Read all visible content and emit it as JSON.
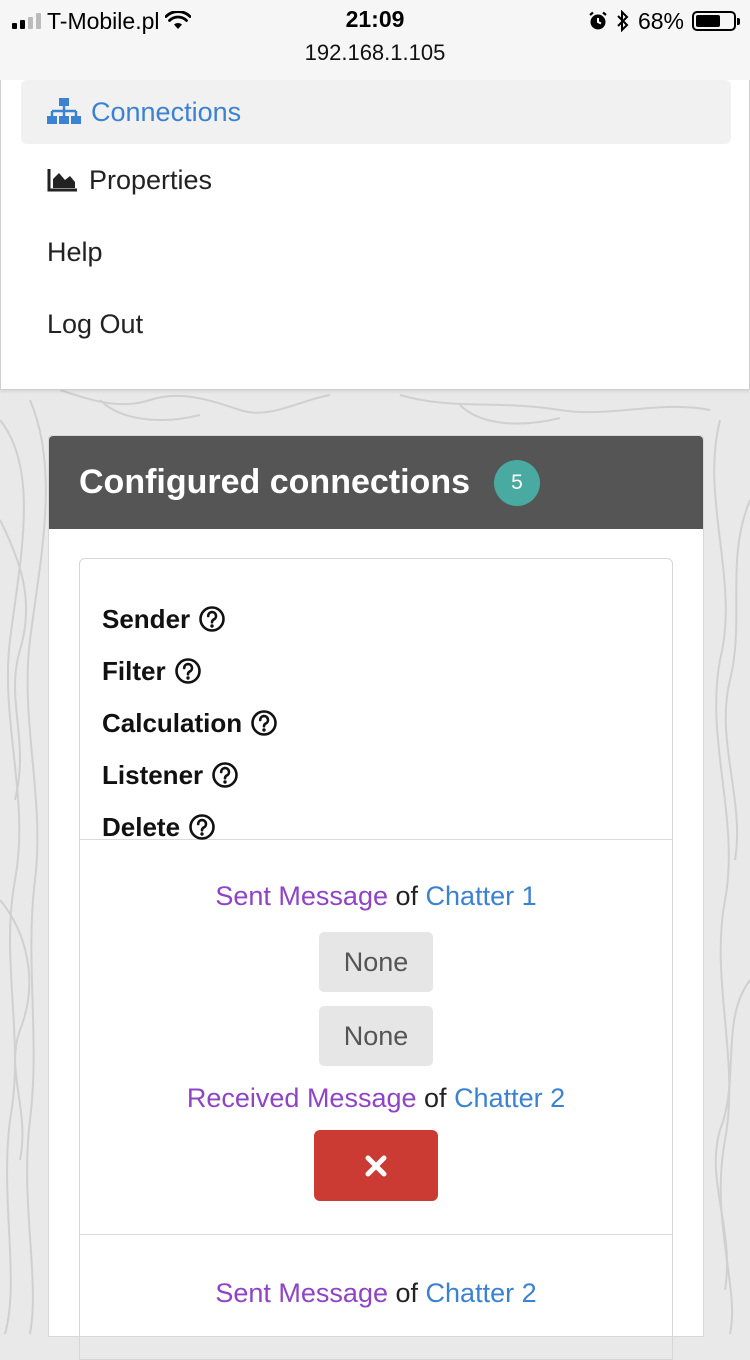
{
  "status_bar": {
    "carrier": "T-Mobile.pl",
    "time": "21:09",
    "url": "192.168.1.105",
    "battery_percent": "68%",
    "battery_level": 0.68
  },
  "nav": {
    "items": [
      {
        "label": "Connections",
        "icon": "sitemap-icon",
        "active": true
      },
      {
        "label": "Properties",
        "icon": "area-chart-icon",
        "active": false
      },
      {
        "label": "Help",
        "active": false
      },
      {
        "label": "Log Out",
        "active": false
      }
    ]
  },
  "panel": {
    "title": "Configured connections",
    "count": "5",
    "legend": [
      "Sender",
      "Filter",
      "Calculation",
      "Listener",
      "Delete"
    ]
  },
  "connections": [
    {
      "sender_event": "Sent Message",
      "of": "of",
      "sender_name": "Chatter 1",
      "filter": "None",
      "calculation": "None",
      "listener_event": "Received Message",
      "listener_name": "Chatter 2"
    },
    {
      "sender_event": "Sent Message",
      "of": "of",
      "sender_name": "Chatter 2"
    }
  ],
  "colors": {
    "accent_blue": "#3b82d0",
    "event_purple": "#8e44c4",
    "header_gray": "#555555",
    "badge_teal": "#48aaa0",
    "delete_red": "#cc3a34"
  }
}
